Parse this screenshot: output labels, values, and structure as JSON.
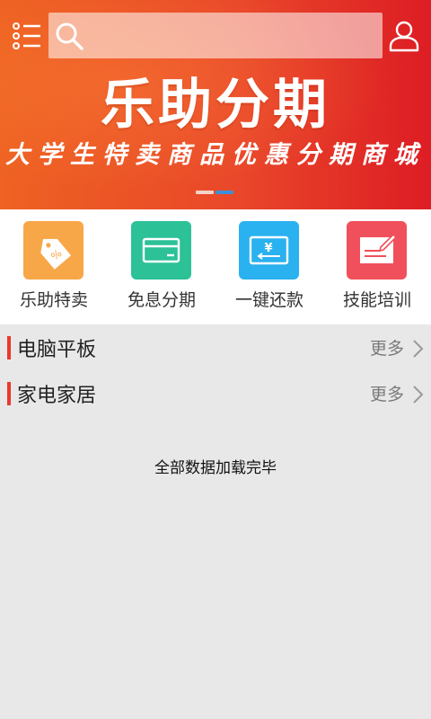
{
  "header": {
    "menu_icon": "menu-list-icon",
    "search": {
      "placeholder": "",
      "icon": "search-icon"
    },
    "user_icon": "user-icon"
  },
  "banner": {
    "title": "乐助分期",
    "subtitle": "大学生特卖商品优惠分期商城",
    "slides_total": 2,
    "active_slide": 2,
    "colors": {
      "start": "#ee6222",
      "end": "#dd1d24"
    }
  },
  "quick_nav": [
    {
      "label": "乐助特卖",
      "icon": "price-tag-icon",
      "color": "#f8a748"
    },
    {
      "label": "免息分期",
      "icon": "card-icon",
      "color": "#2cc197"
    },
    {
      "label": "一键还款",
      "icon": "yuan-repay-icon",
      "color": "#2ab1ef"
    },
    {
      "label": "技能培训",
      "icon": "certificate-pen-icon",
      "color": "#f0505b"
    }
  ],
  "sections": [
    {
      "title": "电脑平板",
      "more": "更多"
    },
    {
      "title": "家电家居",
      "more": "更多"
    }
  ],
  "footer": {
    "status": "全部数据加载完毕"
  },
  "colors": {
    "accent": "#e9392d",
    "background": "#e8e8e8"
  }
}
